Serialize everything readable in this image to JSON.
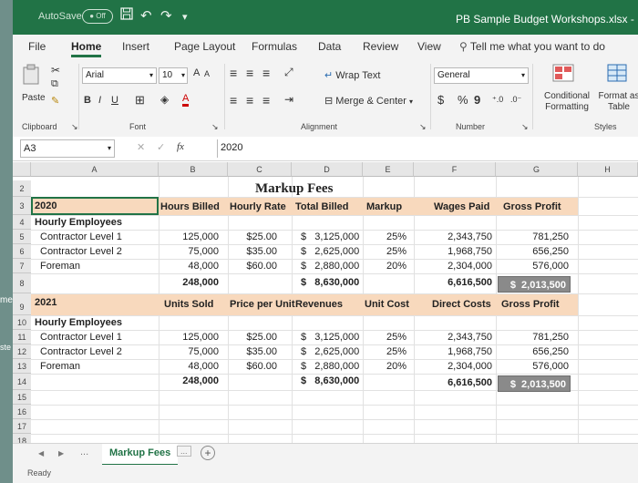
{
  "title_bar": {
    "autosave": "AutoSave",
    "toggle": "● Off",
    "doc_title": "PB Sample Budget Workshops.xlsx - Excel"
  },
  "qat_icons": [
    "save-icon",
    "undo-icon",
    "redo-icon",
    "customize-icon"
  ],
  "tabs": [
    {
      "label": "File"
    },
    {
      "label": "Home",
      "active": true
    },
    {
      "label": "Insert"
    },
    {
      "label": "Page Layout"
    },
    {
      "label": "Formulas"
    },
    {
      "label": "Data"
    },
    {
      "label": "Review"
    },
    {
      "label": "View"
    }
  ],
  "tell_me": "Tell me what you want to do",
  "ribbon": {
    "paste": "Paste",
    "clipboard": "Clipboard",
    "font_name": "Arial",
    "font_size": "10",
    "font_group": "Font",
    "bold": "B",
    "italic": "I",
    "underline": "U",
    "grow_font": "A",
    "shrink_font": "A",
    "wrap_text": "Wrap Text",
    "merge_center": "Merge & Center",
    "alignment_group": "Alignment",
    "number_format": "General",
    "currency": "$",
    "percent": "%",
    "comma": "9",
    "number_group": "Number",
    "conditional_formatting": "Conditional Formatting",
    "format_as_table": "Format as Table",
    "styles_group": "Styles"
  },
  "formula_bar": {
    "name_box": "A3",
    "fx": "fx",
    "value": "2020"
  },
  "columns": [
    "A",
    "B",
    "C",
    "D",
    "E",
    "F",
    "G",
    "H"
  ],
  "rows": [
    "2",
    "3",
    "4",
    "5",
    "6",
    "7",
    "8",
    "9",
    "10",
    "11",
    "12",
    "13",
    "14",
    "15",
    "16",
    "17",
    "18"
  ],
  "left_strip": [
    "me",
    "ste"
  ],
  "sheet": {
    "title": "Markup Fees",
    "section_2020": {
      "year": "2020",
      "headers": {
        "hours": "Hours Billed",
        "rate": "Hourly Rate",
        "total": "Total Billed",
        "markup": "Markup",
        "wages": "Wages Paid",
        "gross": "Gross Profit"
      },
      "group": "Hourly Employees",
      "rows": [
        {
          "name": "Contractor Level 1",
          "hours": "125,000",
          "rate": "$25.00",
          "total": "$   3,125,000",
          "markup": "25%",
          "wages": "2,343,750",
          "gross": "781,250"
        },
        {
          "name": "Contractor Level 2",
          "hours": "75,000",
          "rate": "$35.00",
          "total": "$   2,625,000",
          "markup": "25%",
          "wages": "1,968,750",
          "gross": "656,250"
        },
        {
          "name": "Foreman",
          "hours": "48,000",
          "rate": "$60.00",
          "total": "$   2,880,000",
          "markup": "20%",
          "wages": "2,304,000",
          "gross": "576,000"
        }
      ],
      "totals": {
        "hours": "248,000",
        "total": "$   8,630,000",
        "wages": "6,616,500",
        "gross": "$  2,013,500"
      }
    },
    "section_2021": {
      "year": "2021",
      "headers": {
        "units": "Units Sold",
        "price": "Price per Unit",
        "revenues": "Revenues",
        "unit_cost": "Unit Cost",
        "direct": "Direct Costs",
        "gross": "Gross Profit"
      },
      "group": "Hourly Employees",
      "rows": [
        {
          "name": "Contractor Level 1",
          "hours": "125,000",
          "rate": "$25.00",
          "total": "$   3,125,000",
          "markup": "25%",
          "wages": "2,343,750",
          "gross": "781,250"
        },
        {
          "name": "Contractor Level 2",
          "hours": "75,000",
          "rate": "$35.00",
          "total": "$   2,625,000",
          "markup": "25%",
          "wages": "1,968,750",
          "gross": "656,250"
        },
        {
          "name": "Foreman",
          "hours": "48,000",
          "rate": "$60.00",
          "total": "$   2,880,000",
          "markup": "20%",
          "wages": "2,304,000",
          "gross": "576,000"
        }
      ],
      "totals": {
        "hours": "248,000",
        "total": "$   8,630,000",
        "wages": "6,616,500",
        "gross": "$  2,013,500"
      }
    }
  },
  "sheet_tabs": {
    "nav_prev": "◀",
    "nav_next": "▶",
    "more_left": "...",
    "active": "Markup Fees",
    "more_right": "...",
    "add": "+"
  },
  "status": "Ready",
  "colors": {
    "excel_green": "#217346",
    "band": "#f8d9bd",
    "highlight": "#8a8a8a"
  }
}
